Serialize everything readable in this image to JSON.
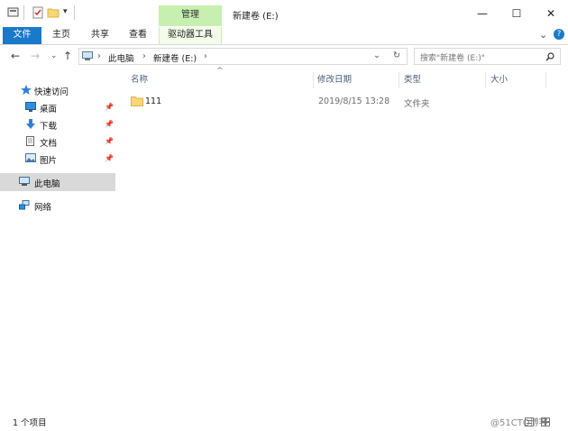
{
  "window": {
    "title": "新建卷 (E:)",
    "context_tab": "管理",
    "controls": {
      "minimize": "—",
      "maximize": "☐",
      "close": "✕"
    }
  },
  "ribbon": {
    "tabs": [
      "文件",
      "主页",
      "共享",
      "查看",
      "驱动器工具"
    ],
    "collapse_glyph": "⌄",
    "help_glyph": "?"
  },
  "address": {
    "crumbs": [
      "此电脑",
      "新建卷 (E:)"
    ],
    "separator": "›",
    "refresh_glyph": "↻",
    "dropdown_glyph": "⌄",
    "search_placeholder": "搜索\"新建卷 (E:)\""
  },
  "nav": {
    "quick_access": "快速访问",
    "items": [
      "桌面",
      "下载",
      "文档",
      "图片"
    ],
    "this_pc": "此电脑",
    "network": "网络"
  },
  "columns": [
    "名称",
    "修改日期",
    "类型",
    "大小"
  ],
  "files": [
    {
      "name": "111",
      "modified": "2019/8/15 13:28",
      "type": "文件夹",
      "size": ""
    }
  ],
  "status": {
    "count": "1 个项目",
    "watermark": "@51CTO博客"
  },
  "colors": {
    "file_tab": "#1979ca",
    "context_tab": "#c6efb0",
    "selection": "#d9d9d9"
  }
}
